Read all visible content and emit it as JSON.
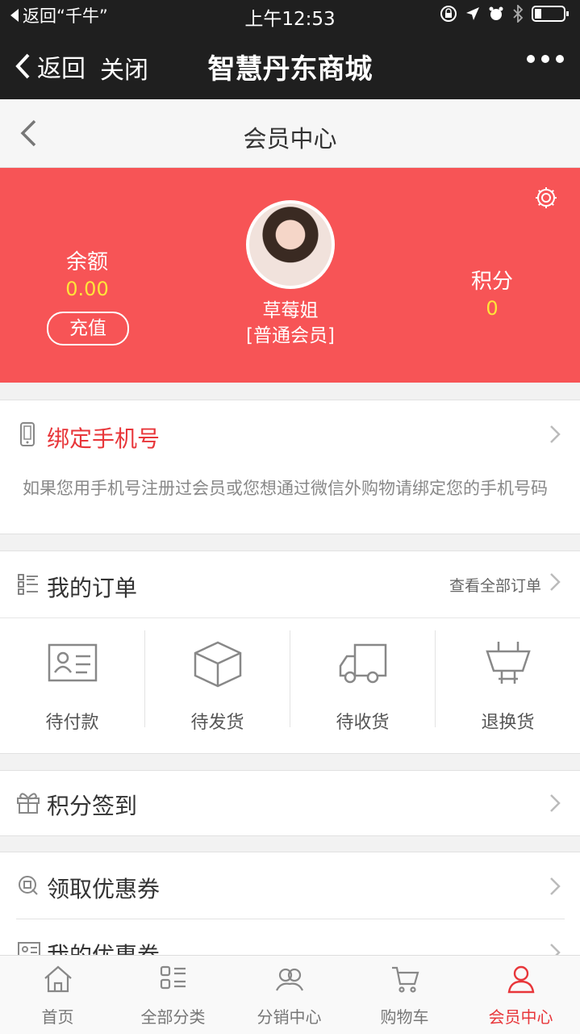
{
  "status_bar": {
    "back_app": "返回“千牛”",
    "time": "上午12:53"
  },
  "wechat_nav": {
    "back": "返回",
    "close": "关闭",
    "title": "智慧丹东商城"
  },
  "page_header": {
    "title": "会员中心"
  },
  "member_card": {
    "balance_label": "余额",
    "balance_value": "0.00",
    "recharge": "充值",
    "username": "草莓姐",
    "level": "[普通会员]",
    "points_label": "积分",
    "points_value": "0"
  },
  "bind_phone": {
    "title": "绑定手机号",
    "desc": "如果您用手机号注册过会员或您想通过微信外购物请绑定您的手机号码"
  },
  "orders": {
    "title": "我的订单",
    "view_all": "查看全部订单",
    "items": [
      "待付款",
      "待发货",
      "待收货",
      "退换货"
    ]
  },
  "sign_in": {
    "title": "积分签到"
  },
  "coupons": {
    "get": "领取优惠券",
    "mine": "我的优惠券"
  },
  "tabbar": {
    "items": [
      "首页",
      "全部分类",
      "分销中心",
      "购物车",
      "会员中心"
    ],
    "active_index": 4
  },
  "colors": {
    "accent": "#e8363a",
    "card_bg": "#f75456",
    "value_yellow": "#ffe43a",
    "nav_bg": "#1f1f1f"
  }
}
